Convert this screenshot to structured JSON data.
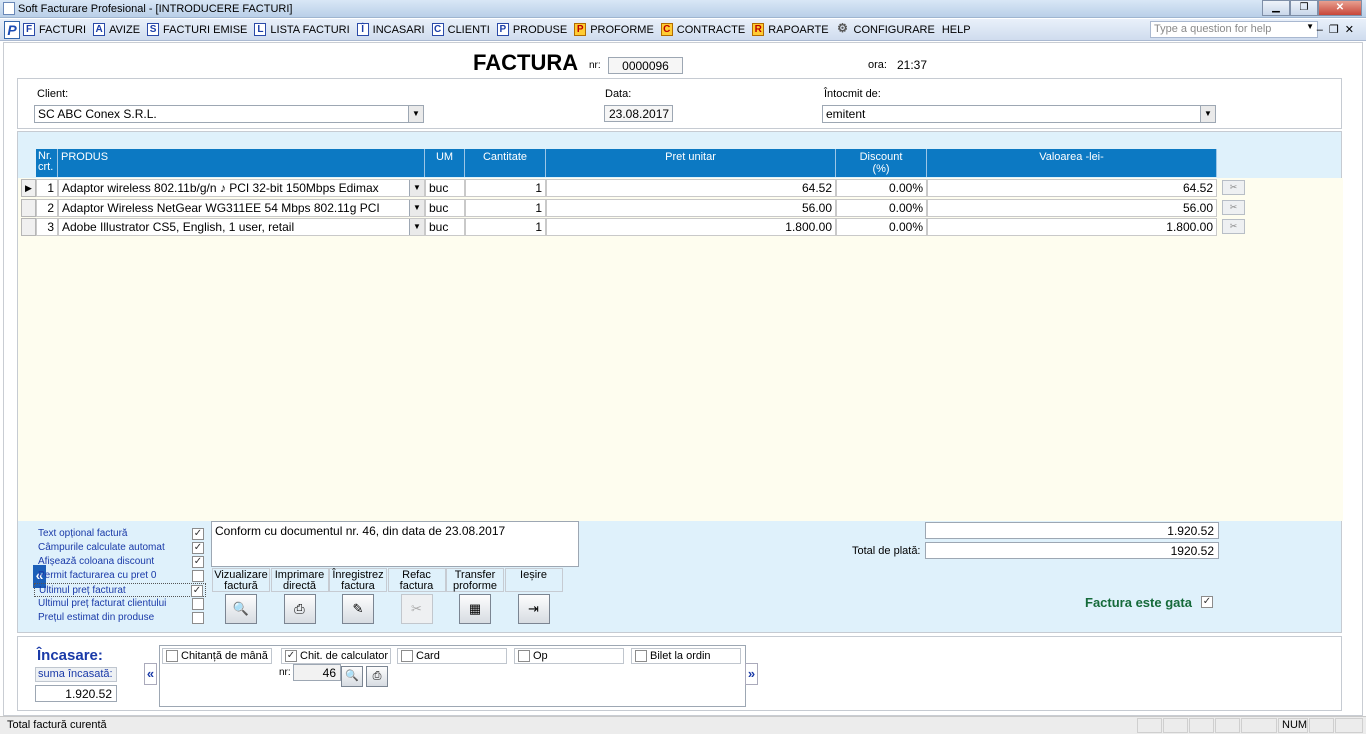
{
  "window": {
    "title": "Soft Facturare Profesional - [INTRODUCERE FACTURI]"
  },
  "menu": {
    "items": [
      {
        "icon": "F",
        "label": "FACTURI"
      },
      {
        "icon": "A",
        "label": "AVIZE"
      },
      {
        "icon": "S",
        "label": "FACTURI EMISE"
      },
      {
        "icon": "L",
        "label": "LISTA FACTURI"
      },
      {
        "icon": "Î",
        "label": "INCASARI"
      },
      {
        "icon": "C",
        "label": "CLIENTI"
      },
      {
        "icon": "P",
        "label": "PRODUSE"
      },
      {
        "icon": "P",
        "label": "PROFORME"
      },
      {
        "icon": "C",
        "label": "CONTRACTE"
      },
      {
        "icon": "R",
        "label": "RAPOARTE"
      },
      {
        "icon": "gear",
        "label": "CONFIGURARE"
      },
      {
        "icon": "",
        "label": "HELP"
      }
    ],
    "help_placeholder": "Type a question for help"
  },
  "invoice": {
    "title": "FACTURA",
    "nr_label": "nr:",
    "nr": "0000096",
    "ora_label": "ora:",
    "ora": "21:37",
    "client_label": "Client:",
    "client": "SC ABC Conex S.R.L.",
    "data_label": "Data:",
    "data": "23.08.2017",
    "intocmit_label": "Întocmit de:",
    "intocmit": "emitent"
  },
  "grid": {
    "headers": {
      "nr": "Nr. crt.",
      "produs": "PRODUS",
      "um": "UM",
      "cantitate": "Cantitate",
      "pret": "Pret unitar",
      "discount": "Discount (%)",
      "valoare": "Valoarea -lei-"
    },
    "rows": [
      {
        "nr": "1",
        "produs": "Adaptor wireless 802.11b/g/n ♪ PCI 32-bit 150Mbps Edimax",
        "um": "buc",
        "cantitate": "1",
        "pret": "64.52",
        "discount": "0.00%",
        "valoare": "64.52",
        "current": true
      },
      {
        "nr": "2",
        "produs": "Adaptor Wireless NetGear WG311EE 54 Mbps 802.11g PCI",
        "um": "buc",
        "cantitate": "1",
        "pret": "56.00",
        "discount": "0.00%",
        "valoare": "56.00",
        "current": false
      },
      {
        "nr": "3",
        "produs": "Adobe Illustrator CS5, English, 1 user, retail",
        "um": "buc",
        "cantitate": "1",
        "pret": "1.800.00",
        "discount": "0.00%",
        "valoare": "1.800.00",
        "current": false
      }
    ]
  },
  "options": [
    {
      "label": "Text opțional factură",
      "checked": true
    },
    {
      "label": "Câmpurile calculate automat",
      "checked": true
    },
    {
      "label": "Afișează coloana discount",
      "checked": true
    },
    {
      "label": "Permit facturarea cu pret 0",
      "checked": false
    },
    {
      "label": "Ultimul preț facturat",
      "checked": true,
      "highlight": true
    },
    {
      "label": "Ultimul preț facturat clientului",
      "checked": false
    },
    {
      "label": "Prețul estimat din produse",
      "checked": false
    }
  ],
  "note": "Conform cu documentul nr. 46, din data de 23.08.2017",
  "actions": [
    {
      "line1": "Vizualizare",
      "line2": "factură"
    },
    {
      "line1": "Imprimare",
      "line2": "directă"
    },
    {
      "line1": "Înregistrez",
      "line2": "factura"
    },
    {
      "line1": "Refac",
      "line2": "factura"
    },
    {
      "line1": "Transfer",
      "line2": "proforme"
    },
    {
      "line1": "Ieșire",
      "line2": ""
    }
  ],
  "totals": {
    "subtotal": "1.920.52",
    "total_label": "Total de plată:",
    "total": "1920.52",
    "gata_label": "Factura este gata",
    "gata_checked": true
  },
  "incasare": {
    "title": "Încasare:",
    "suma_label": "suma încasată:",
    "suma": "1.920.52",
    "methods": [
      {
        "label": "Chitanță de mână",
        "checked": false
      },
      {
        "label": "Chit. de calculator",
        "checked": true
      },
      {
        "label": "Card",
        "checked": false
      },
      {
        "label": "Op",
        "checked": false
      },
      {
        "label": "Bilet la ordin",
        "checked": false
      }
    ],
    "nr_label": "nr:",
    "nr": "46"
  },
  "status": {
    "text": "Total factură curentă",
    "num": "NUM"
  }
}
